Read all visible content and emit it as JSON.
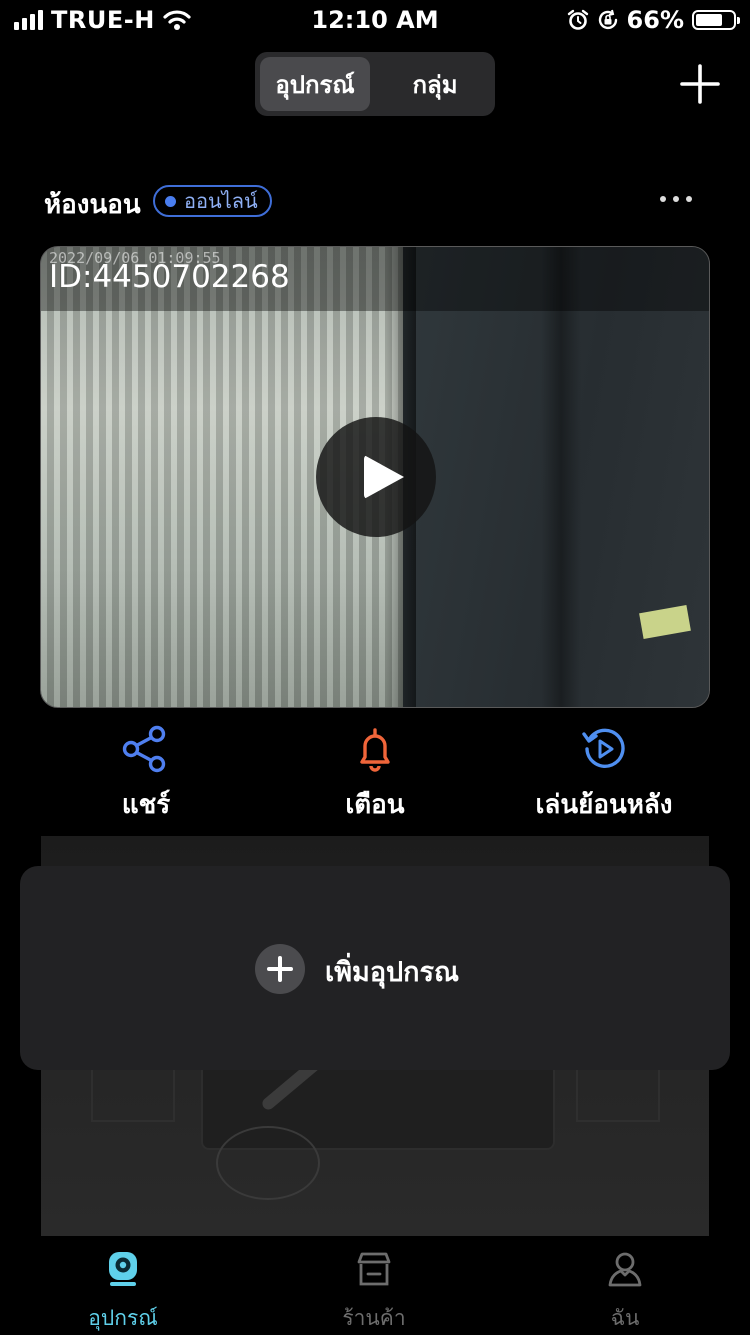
{
  "status_bar": {
    "carrier": "TRUE-H",
    "time": "12:10 AM",
    "battery_percent": "66%",
    "battery_level": 0.66,
    "icons": [
      "signal-icon",
      "wifi-icon",
      "alarm-icon",
      "rotation-lock-icon",
      "battery-icon"
    ]
  },
  "segmented_control": {
    "tabs": [
      {
        "label": "อุปกรณ์",
        "selected": true
      },
      {
        "label": "กลุ่ม",
        "selected": false
      }
    ]
  },
  "header": {
    "add_icon": "plus-icon"
  },
  "device": {
    "name": "ห้องนอน",
    "status": "ออนไลน์",
    "more_icon": "more-dots-icon",
    "video": {
      "timestamp": "2022/09/06 01:09:55",
      "camera_id": "ID:4450702268",
      "play_icon": "play-icon"
    },
    "actions": [
      {
        "label": "แชร์",
        "icon": "share-icon",
        "color": "#4f7ff0"
      },
      {
        "label": "เตือน",
        "icon": "bell-icon",
        "color": "#f0653a"
      },
      {
        "label": "เล่นย้อนหลัง",
        "icon": "replay-icon",
        "color": "#4f8ff0"
      }
    ]
  },
  "add_device": {
    "label": "เพิ่มอุปกรณ",
    "icon": "plus-circle-icon"
  },
  "tab_bar": {
    "tabs": [
      {
        "label": "อุปกรณ์",
        "icon": "camera-icon",
        "active": true
      },
      {
        "label": "ร้านค้า",
        "icon": "store-icon",
        "active": false
      },
      {
        "label": "ฉัน",
        "icon": "person-icon",
        "active": false
      }
    ],
    "active_color": "#5fd0ea",
    "inactive_color": "#6d6d6d"
  }
}
